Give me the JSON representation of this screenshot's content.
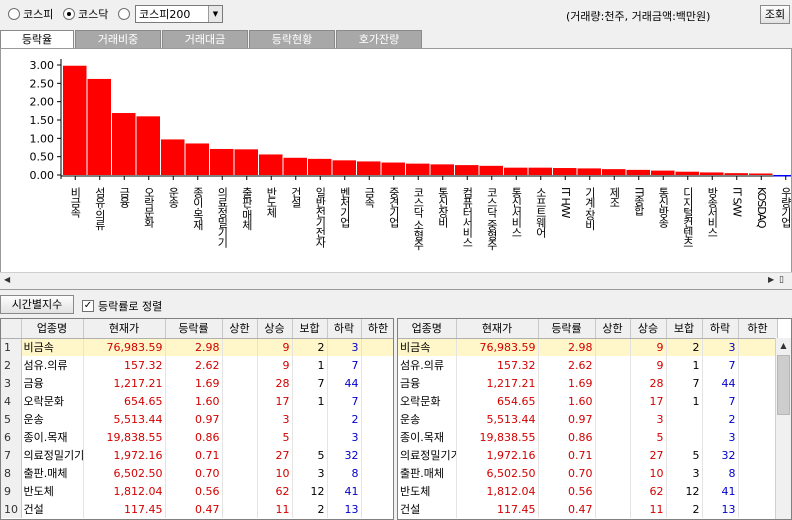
{
  "market": {
    "options": [
      {
        "label": "코스피",
        "selected": false
      },
      {
        "label": "코스닥",
        "selected": true
      },
      {
        "label": "",
        "selected": false
      }
    ],
    "index_select": "코스피200"
  },
  "unit_note": "(거래량:천주, 거래금액:백만원)",
  "query_button": "조회",
  "tabs": [
    "등락율",
    "거래비중",
    "거래대금",
    "등락현황",
    "호가잔량"
  ],
  "active_tab": 0,
  "period_button": "시간별지수",
  "sort_checkbox": {
    "label": "등락률로 정렬",
    "checked": true
  },
  "colors": {
    "bar_positive": "#ff0000",
    "bar_negative": "#0000ff",
    "up_text": "#d40000",
    "down_text": "#0000cc",
    "selected_row": "#fff6c9"
  },
  "chart_data": {
    "type": "bar",
    "categories": [
      "비금속",
      "섬유·의류",
      "금융",
      "오락문화",
      "운송",
      "종이·목재",
      "의료정밀기기",
      "출판·매체",
      "반도체",
      "건설",
      "일반전기전자",
      "벤처기업",
      "금속",
      "중견기업",
      "코스닥 소형주",
      "통신장비",
      "컴퓨터서비스",
      "코스닥 중형주",
      "통신서비스",
      "소프트웨어",
      "IT H/W",
      "기계·장비",
      "제조",
      "IT종합",
      "통신방송",
      "디지털컨텐츠",
      "방송서비스",
      "IT S/W",
      "KOSDAQ",
      "우량기업"
    ],
    "values": [
      2.98,
      2.62,
      1.69,
      1.6,
      0.97,
      0.86,
      0.71,
      0.7,
      0.56,
      0.47,
      0.44,
      0.4,
      0.37,
      0.34,
      0.31,
      0.29,
      0.27,
      0.25,
      0.2,
      0.2,
      0.19,
      0.18,
      0.16,
      0.14,
      0.12,
      0.09,
      0.07,
      0.05,
      0.04,
      -0.03
    ],
    "yticks": [
      "3.00",
      "2.50",
      "2.00",
      "1.50",
      "1.00",
      "0.50",
      "0.00"
    ],
    "ylim": [
      0,
      3.0
    ],
    "grid": false,
    "legend": "none"
  },
  "table_headers": [
    "",
    "업종명",
    "현재가",
    "등락률",
    "상한",
    "상승",
    "보합",
    "하락",
    "하한"
  ],
  "rows": [
    {
      "no": "1",
      "name": "비금속",
      "price": "76,983.59",
      "rate": "2.98",
      "upper": "",
      "up": "9",
      "flat": "2",
      "down": "3",
      "lower": ""
    },
    {
      "no": "2",
      "name": "섬유.의류",
      "price": "157.32",
      "rate": "2.62",
      "upper": "",
      "up": "9",
      "flat": "1",
      "down": "7",
      "lower": ""
    },
    {
      "no": "3",
      "name": "금융",
      "price": "1,217.21",
      "rate": "1.69",
      "upper": "",
      "up": "28",
      "flat": "7",
      "down": "44",
      "lower": ""
    },
    {
      "no": "4",
      "name": "오락문화",
      "price": "654.65",
      "rate": "1.60",
      "upper": "",
      "up": "17",
      "flat": "1",
      "down": "7",
      "lower": ""
    },
    {
      "no": "5",
      "name": "운송",
      "price": "5,513.44",
      "rate": "0.97",
      "upper": "",
      "up": "3",
      "flat": "",
      "down": "2",
      "lower": ""
    },
    {
      "no": "6",
      "name": "종이.목재",
      "price": "19,838.55",
      "rate": "0.86",
      "upper": "",
      "up": "5",
      "flat": "",
      "down": "3",
      "lower": ""
    },
    {
      "no": "7",
      "name": "의료정밀기기",
      "price": "1,972.16",
      "rate": "0.71",
      "upper": "",
      "up": "27",
      "flat": "5",
      "down": "32",
      "lower": ""
    },
    {
      "no": "8",
      "name": "출판.매체",
      "price": "6,502.50",
      "rate": "0.70",
      "upper": "",
      "up": "10",
      "flat": "3",
      "down": "8",
      "lower": ""
    },
    {
      "no": "9",
      "name": "반도체",
      "price": "1,812.04",
      "rate": "0.56",
      "upper": "",
      "up": "62",
      "flat": "12",
      "down": "41",
      "lower": ""
    },
    {
      "no": "10",
      "name": "건설",
      "price": "117.45",
      "rate": "0.47",
      "upper": "",
      "up": "11",
      "flat": "2",
      "down": "13",
      "lower": ""
    }
  ]
}
